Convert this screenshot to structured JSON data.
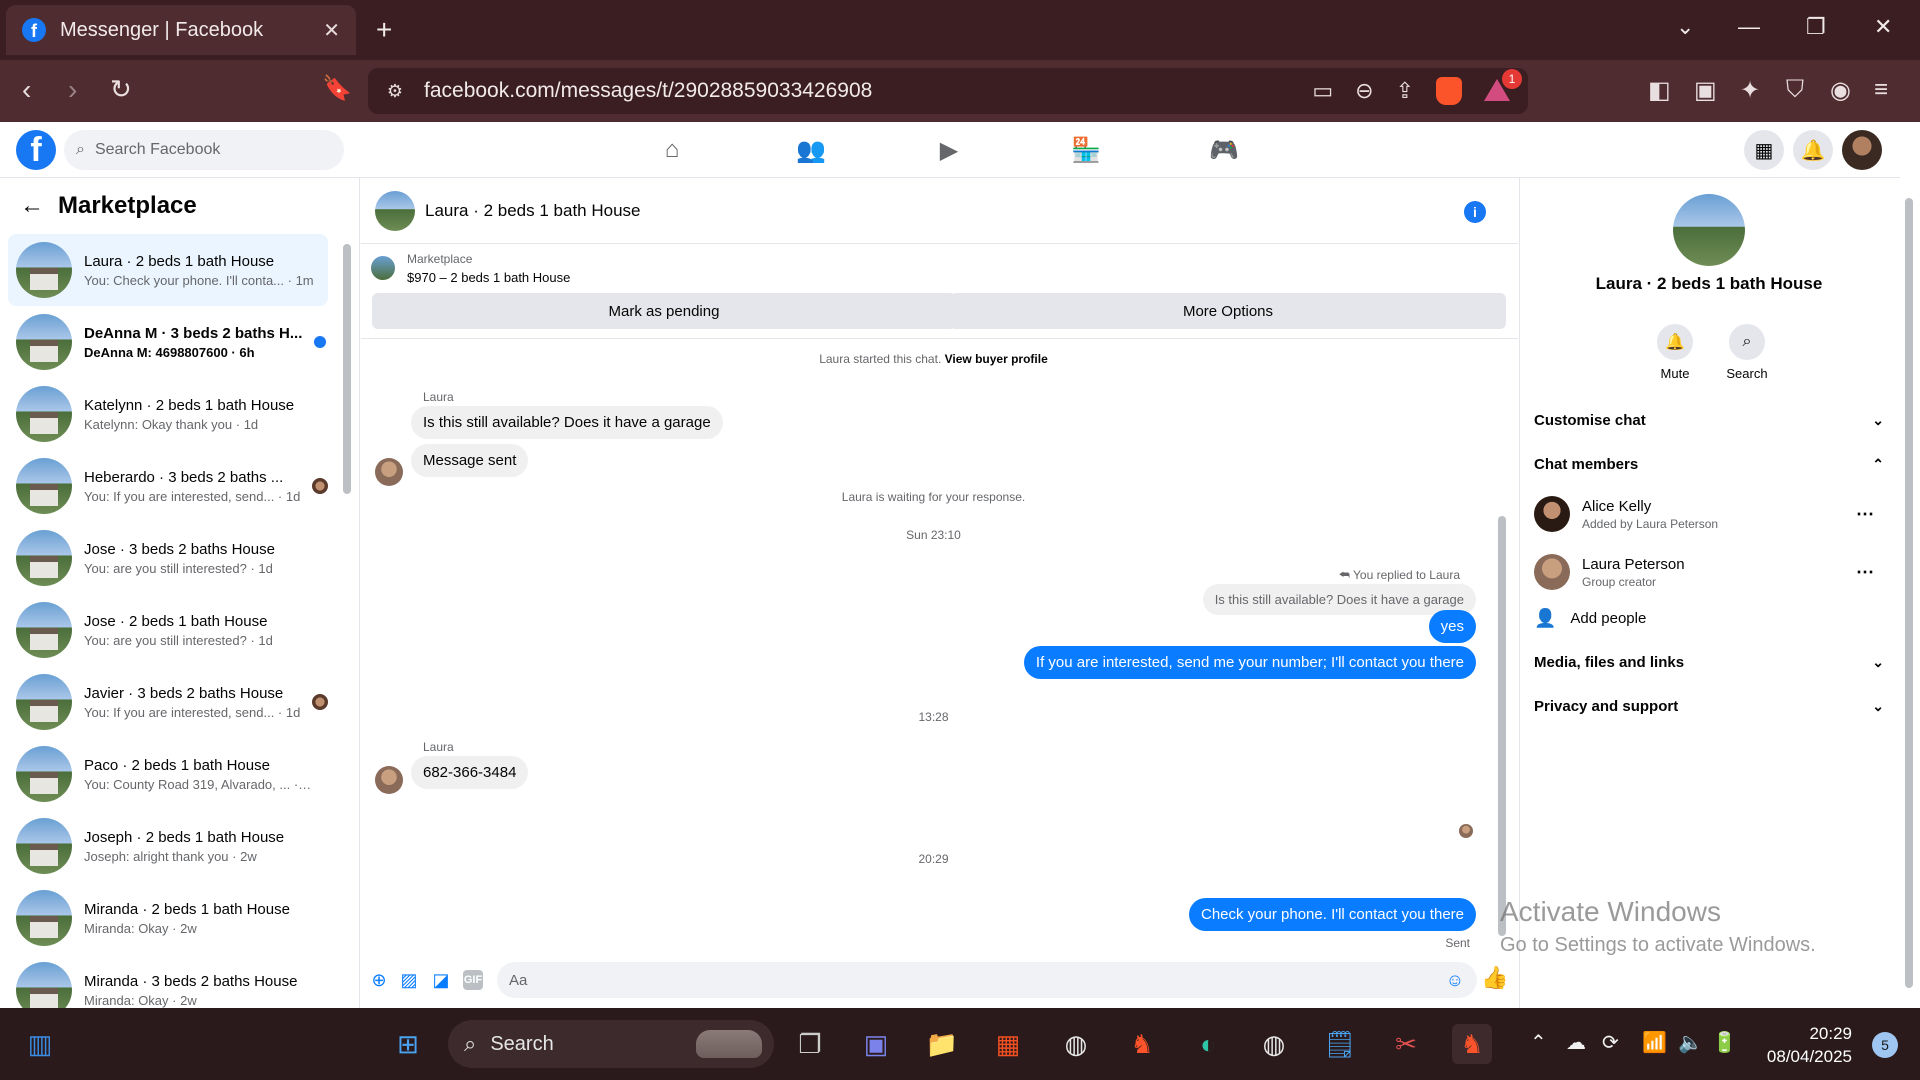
{
  "browser": {
    "tab_title": "Messenger | Facebook",
    "url": "facebook.com/messages/t/29028859033426908",
    "rewards_badge": "1"
  },
  "fb": {
    "search_placeholder": "Search Facebook"
  },
  "sidebar": {
    "title": "Marketplace",
    "conversations": [
      {
        "name": "Laura · 2 beds 1 bath House",
        "preview": "You: Check your phone. I'll conta... · 1m"
      },
      {
        "name": "DeAnna M · 3 beds 2 baths H...",
        "preview": "DeAnna M: 4698807600 · 6h"
      },
      {
        "name": "Katelynn · 2 beds 1 bath House",
        "preview": "Katelynn: Okay thank you · 1d"
      },
      {
        "name": "Heberardo · 3 beds 2 baths ...",
        "preview": "You: If you are interested, send... · 1d"
      },
      {
        "name": "Jose · 3 beds 2 baths House",
        "preview": "You: are you still interested? · 1d"
      },
      {
        "name": "Jose · 2 beds 1 bath House",
        "preview": "You: are you still interested? · 1d"
      },
      {
        "name": "Javier · 3 beds 2 baths House",
        "preview": "You: If you are interested, send... · 1d"
      },
      {
        "name": "Paco · 2 beds 1 bath House",
        "preview": "You: County Road 319, Alvarado, ... · 1d"
      },
      {
        "name": "Joseph · 2 beds 1 bath House",
        "preview": "Joseph: alright thank you · 2w"
      },
      {
        "name": "Miranda · 2 beds 1 bath House",
        "preview": "Miranda: Okay · 2w"
      },
      {
        "name": "Miranda · 3 beds 2 baths House",
        "preview": "Miranda: Okay · 2w"
      }
    ]
  },
  "chat": {
    "title": "Laura · 2 beds 1 bath House",
    "marketplace_label": "Marketplace",
    "listing": "$970 – 2 beds 1 bath House",
    "mark_pending": "Mark as pending",
    "more_options": "More Options",
    "started_note": "Laura started this chat.",
    "view_profile": "View buyer profile",
    "sender1": "Laura",
    "msg1": "Is this still available? Does it have a garage",
    "msg2": "Message sent",
    "waiting_note": "Laura is waiting for your response.",
    "time1": "Sun 23:10",
    "replied_to": "You replied to Laura",
    "quoted": "Is this still available? Does it have a garage",
    "out1": "yes",
    "out2": "If you are interested, send me your number; I'll contact you there",
    "time2": "13:28",
    "sender2": "Laura",
    "msg3": "682-366-3484",
    "time3": "20:29",
    "out3": "Check your phone. I'll contact you there",
    "sent_status": "Sent",
    "composer_placeholder": "Aa",
    "gif_label": "GIF"
  },
  "right_panel": {
    "title": "Laura · 2 beds 1 bath House",
    "mute": "Mute",
    "search": "Search",
    "customise": "Customise chat",
    "members_header": "Chat members",
    "members": [
      {
        "name": "Alice Kelly",
        "sub": "Added by Laura Peterson"
      },
      {
        "name": "Laura Peterson",
        "sub": "Group creator"
      }
    ],
    "add_people": "Add people",
    "media": "Media, files and links",
    "privacy": "Privacy and support"
  },
  "watermark": {
    "line1": "Activate Windows",
    "line2": "Go to Settings to activate Windows."
  },
  "taskbar": {
    "search": "Search",
    "time": "20:29",
    "date": "08/04/2025",
    "notifications": "5"
  },
  "colors": {
    "accent": "#1877f2",
    "outgoing_bubble": "#0a7cff",
    "browser_frame": "#3a1e21"
  }
}
